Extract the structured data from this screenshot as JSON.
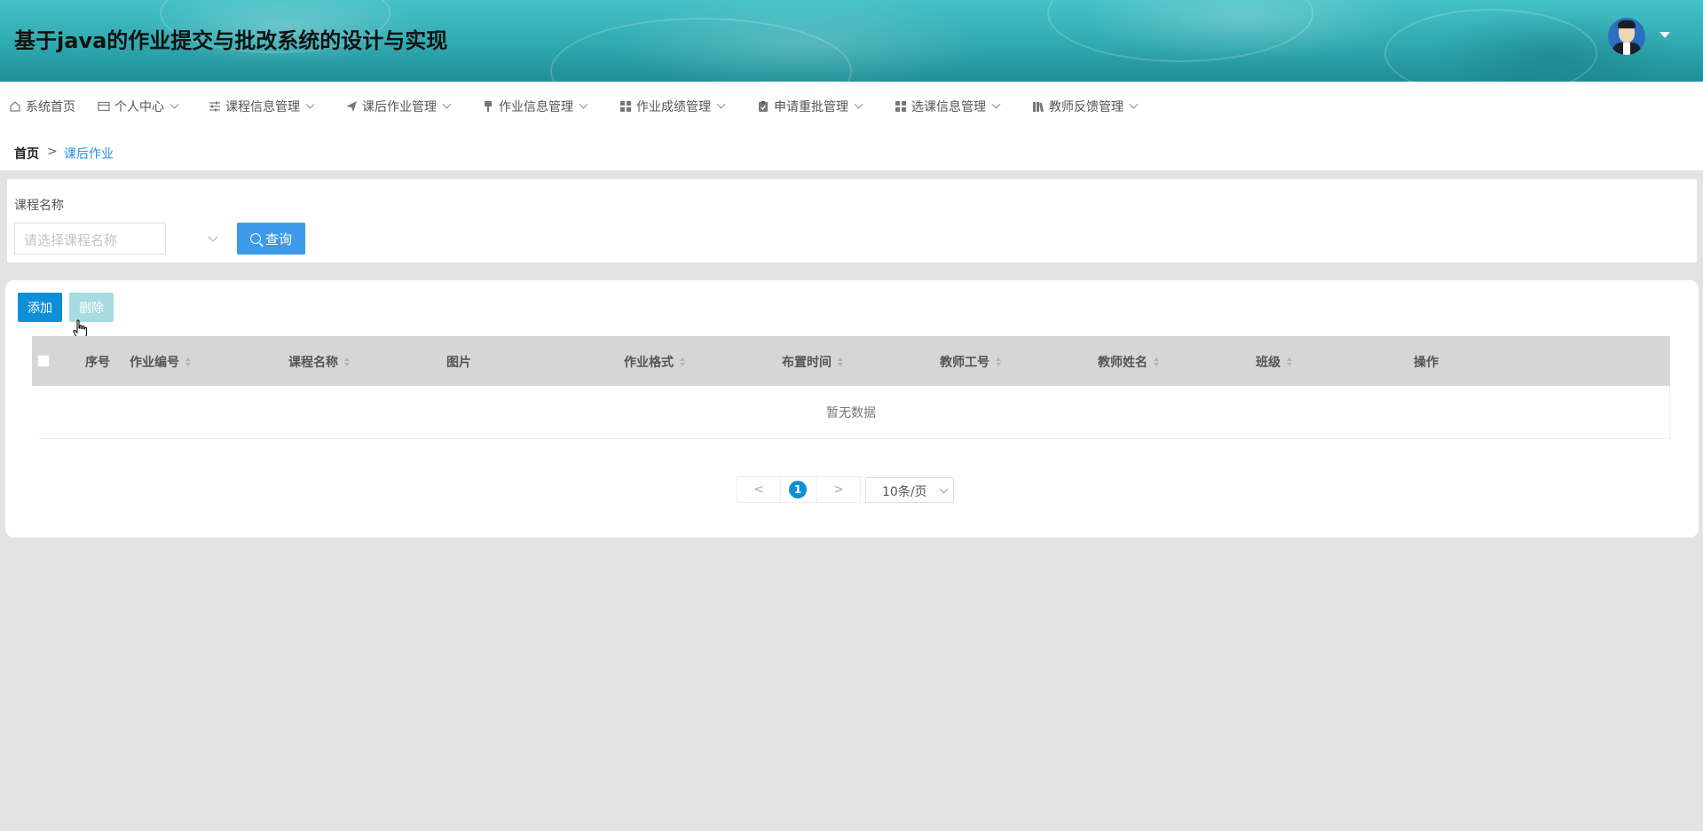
{
  "header": {
    "title": "基于java的作业提交与批改系统的设计与实现",
    "avatar_icon": "user-avatar",
    "caret_icon": "caret-down-icon"
  },
  "nav": {
    "items": [
      {
        "label": "系统首页",
        "icon": "home-icon",
        "has_dropdown": false
      },
      {
        "label": "个人中心",
        "icon": "id-card-icon",
        "has_dropdown": true
      },
      {
        "label": "课程信息管理",
        "icon": "sliders-icon",
        "has_dropdown": true
      },
      {
        "label": "课后作业管理",
        "icon": "paper-plane-icon",
        "has_dropdown": true
      },
      {
        "label": "作业信息管理",
        "icon": "brush-icon",
        "has_dropdown": true
      },
      {
        "label": "作业成绩管理",
        "icon": "grid-icon",
        "has_dropdown": true
      },
      {
        "label": "申请重批管理",
        "icon": "clipboard-check-icon",
        "has_dropdown": true
      },
      {
        "label": "选课信息管理",
        "icon": "grid-icon",
        "has_dropdown": true
      },
      {
        "label": "教师反馈管理",
        "icon": "books-icon",
        "has_dropdown": true
      }
    ]
  },
  "breadcrumb": {
    "home": "首页",
    "separator": ">",
    "current": "课后作业"
  },
  "search": {
    "label": "课程名称",
    "placeholder": "请选择课程名称",
    "query_button": "查询"
  },
  "actions": {
    "add": "添加",
    "delete": "删除"
  },
  "table": {
    "columns": [
      {
        "label": "序号",
        "sortable": false
      },
      {
        "label": "作业编号",
        "sortable": true
      },
      {
        "label": "课程名称",
        "sortable": true
      },
      {
        "label": "图片",
        "sortable": false
      },
      {
        "label": "作业格式",
        "sortable": true
      },
      {
        "label": "布置时间",
        "sortable": true
      },
      {
        "label": "教师工号",
        "sortable": true
      },
      {
        "label": "教师姓名",
        "sortable": true
      },
      {
        "label": "班级",
        "sortable": true
      },
      {
        "label": "操作",
        "sortable": false
      }
    ],
    "rows": [],
    "empty_text": "暂无数据"
  },
  "pagination": {
    "prev": "<",
    "next": ">",
    "current_page": "1",
    "page_size": "10条/页"
  },
  "colors": {
    "primary": "#0f8fd8",
    "query_button": "#3d9be9",
    "delete_disabled": "#a6dbe0",
    "header_teal": "#2fa9b0",
    "page_background": "#e3e3e3"
  }
}
